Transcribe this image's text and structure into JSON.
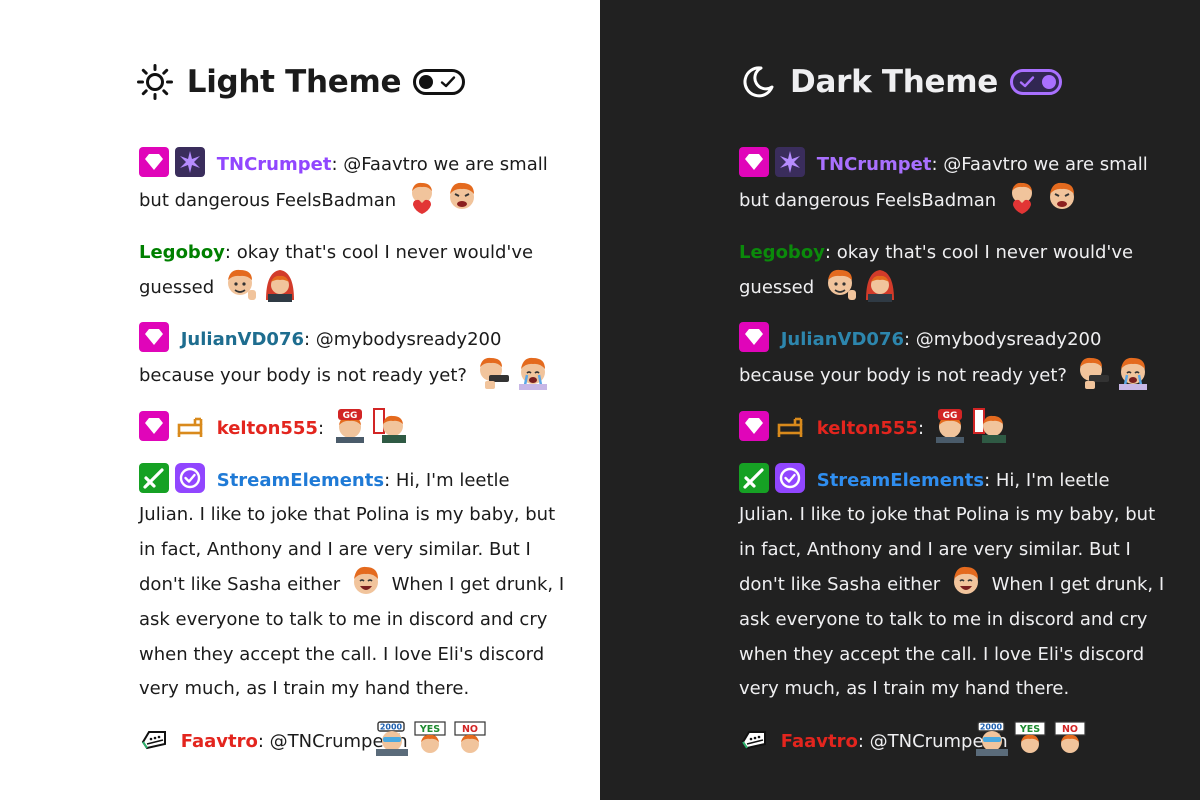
{
  "themes": [
    {
      "title": "Light Theme",
      "icon": "sun-icon",
      "toggle_state": "off"
    },
    {
      "title": "Dark Theme",
      "icon": "moon-icon",
      "toggle_state": "on"
    }
  ],
  "colors": {
    "light_bg": "#ffffff",
    "dark_bg": "#212121",
    "accent_purple": "#9146ff",
    "dark_toggle": "#a970ff"
  },
  "messages": [
    {
      "badges": [
        "gem-badge",
        "sparkle-badge"
      ],
      "user": "TNCrumpet",
      "sep": ": ",
      "text": "@Faavtro we are small but dangerous FeelsBadman",
      "emotes": [
        "heart-emote",
        "angry-emote"
      ]
    },
    {
      "badges": [],
      "user": "Legoboy",
      "sep": ": ",
      "text": "okay that's cool I never would've guessed",
      "emotes": [
        "wave-emote",
        "hood-emote"
      ]
    },
    {
      "badges": [
        "gem-badge"
      ],
      "user": "JulianVD076",
      "sep": ": ",
      "text": "@mybodysready200 because your body is not ready yet?",
      "emotes": [
        "gun-emote",
        "cry-emote"
      ]
    },
    {
      "badges": [
        "gem-badge",
        "bed-badge"
      ],
      "user": "kelton555",
      "sep": ": ",
      "text": "",
      "emotes": [
        "gg-emote",
        "sign-emote"
      ]
    },
    {
      "badges": [
        "sword-badge",
        "verified-badge"
      ],
      "user": "StreamElements",
      "sep": ": ",
      "text_before": "Hi, I'm leetle Julian. I like to joke that Polina is my baby, but in fact, Anthony and I are very similar. But I don't like Sasha either",
      "text_after": " When I get drunk, I ask everyone to talk to me in discord and cry when they accept the call. I love Eli's discord very much, as I train my hand there.",
      "emotes": [
        "laugh-emote"
      ]
    },
    {
      "badges": [
        "keyboard-badge"
      ],
      "user": "Faavtro",
      "sep": ": ",
      "text": "@TNCrumpet h",
      "emotes": [
        "2000-emote",
        "yes-emote",
        "no-emote"
      ],
      "emote_labels": [
        "2000",
        "YES",
        "NO"
      ]
    }
  ],
  "emote_text": {
    "gg": "GG"
  }
}
